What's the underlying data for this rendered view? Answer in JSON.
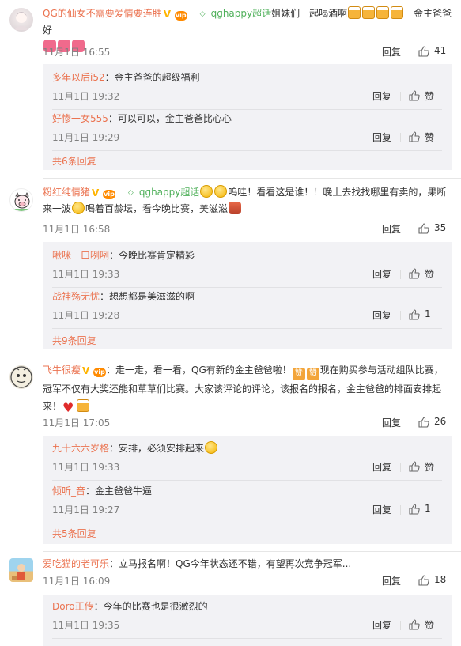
{
  "ui": {
    "reply_label": "回复",
    "zan_label": "赞",
    "emoji_zan": "赞"
  },
  "comments": [
    {
      "username": "QG的仙女不需要爱情要连胜",
      "topic": "qghappy超话",
      "text": "姐妹们一起喝酒啊",
      "text_tail": "金主爸爸好",
      "time": "11月1日 16:55",
      "likes": "41",
      "replies": [
        {
          "username": "多年以后i52",
          "text": "：金主爸爸的超级福利",
          "time": "11月1日 19:32",
          "likes": ""
        },
        {
          "username": "好惨一女555",
          "text": "：可以可以，金主爸爸比心心",
          "time": "11月1日 19:29",
          "likes": ""
        }
      ],
      "more": "共6条回复"
    },
    {
      "username": "粉红纯情猪",
      "topic": "qghappy超话",
      "text": "呜哇！看看这是谁！！晚上去找找哪里有卖的，果断",
      "text_line2a": "来一波",
      "text_line2b": "喝着百龄坛，看今晚比赛，美滋滋",
      "time": "11月1日 16:58",
      "likes": "35",
      "replies": [
        {
          "username": "啾咪一口咧咧",
          "text": "：今晚比赛肯定精彩",
          "time": "11月1日 19:33",
          "likes": ""
        },
        {
          "username": "战神殇无忧",
          "text": "：想想都是美滋滋的啊",
          "time": "11月1日 19:28",
          "likes": "1"
        }
      ],
      "more": "共9条回复"
    },
    {
      "username": "飞牛很瘦",
      "text": "：走一走，看一看，QG有新的金主爸爸啦！",
      "text_tail": "现在购买参与活动组队比赛，",
      "text_line2": "冠军不仅有大奖还能和草草们比赛。大家该评论的评论，该报名的报名，金主爸爸的排面安排起",
      "text_line3": "来！",
      "time": "11月1日 17:05",
      "likes": "26",
      "replies": [
        {
          "username": "九十六六岁格",
          "text": "：安排，必须安排起来",
          "time": "11月1日 19:33",
          "likes": ""
        },
        {
          "username": "倾听_音",
          "text": "：金主爸爸牛逼",
          "time": "11月1日 19:27",
          "likes": "1"
        }
      ],
      "more": "共5条回复"
    },
    {
      "username": "爱吃猫的老可乐",
      "text": "：立马报名啊！QG今年状态还不错，有望再次竞争冠军...",
      "time": "11月1日 16:09",
      "likes": "18",
      "replies": [
        {
          "username": "Doro正传",
          "text": "：今年的比赛也是很激烈的",
          "time": "11月1日 19:35",
          "likes": ""
        }
      ]
    }
  ]
}
